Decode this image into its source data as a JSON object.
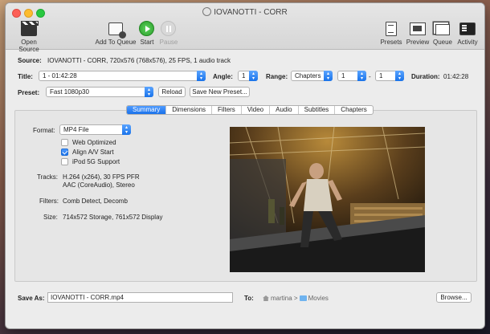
{
  "window": {
    "title": "IOVANOTTI - CORR"
  },
  "toolbar": {
    "open_source": "Open Source",
    "add_to_queue": "Add To Queue",
    "start": "Start",
    "pause": "Pause",
    "presets": "Presets",
    "preview": "Preview",
    "queue": "Queue",
    "activity": "Activity"
  },
  "source": {
    "label": "Source:",
    "value": "IOVANOTTI - CORR, 720x576 (768x576), 25 FPS, 1 audio track"
  },
  "title_row": {
    "title_label": "Title:",
    "title_value": "1 - 01:42:28",
    "angle_label": "Angle:",
    "angle_value": "1",
    "range_label": "Range:",
    "range_type": "Chapters",
    "range_start": "1",
    "range_sep": "-",
    "range_end": "1",
    "duration_label": "Duration:",
    "duration_value": "01:42:28"
  },
  "preset": {
    "label": "Preset:",
    "value": "Fast 1080p30",
    "reload": "Reload",
    "save_new": "Save New Preset..."
  },
  "tabs": [
    {
      "label": "Summary",
      "active": true
    },
    {
      "label": "Dimensions",
      "active": false
    },
    {
      "label": "Filters",
      "active": false
    },
    {
      "label": "Video",
      "active": false
    },
    {
      "label": "Audio",
      "active": false
    },
    {
      "label": "Subtitles",
      "active": false
    },
    {
      "label": "Chapters",
      "active": false
    }
  ],
  "summary": {
    "format_label": "Format:",
    "format_value": "MP4 File",
    "web_optimized": "Web Optimized",
    "web_optimized_checked": false,
    "align_av": "Align A/V Start",
    "align_av_checked": true,
    "ipod": "iPod 5G Support",
    "ipod_checked": false,
    "tracks_label": "Tracks:",
    "tracks_line1": "H.264 (x264), 30 FPS PFR",
    "tracks_line2": "AAC (CoreAudio), Stereo",
    "filters_label": "Filters:",
    "filters_value": "Comb Detect, Decomb",
    "size_label": "Size:",
    "size_value": "714x572 Storage, 761x572 Display"
  },
  "save": {
    "label": "Save As:",
    "value": "IOVANOTTI - CORR.mp4",
    "to_label": "To:",
    "path_user": "martina",
    "path_sep": ">",
    "path_folder": "Movies",
    "browse": "Browse..."
  },
  "colors": {
    "accent": "#1a72ea",
    "start_green": "#2a9d2a"
  }
}
